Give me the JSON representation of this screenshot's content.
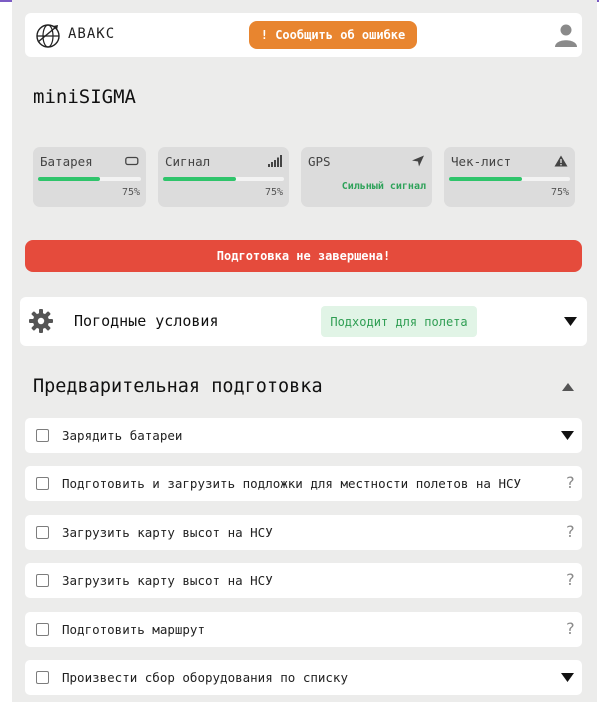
{
  "header": {
    "logo_text": "АВАКС",
    "report_button": "! Сообщить об ошибке"
  },
  "page_title": "miniSIGMA",
  "stats": [
    {
      "label": "Батарея",
      "percent": "75%",
      "progress": 0.6
    },
    {
      "label": "Сигнал",
      "percent": "75%",
      "progress": 0.6
    },
    {
      "label": "GPS",
      "status": "Сильный сигнал"
    },
    {
      "label": "Чек-лист",
      "percent": "75%",
      "progress": 0.6
    }
  ],
  "alert": "Подготовка не завершена!",
  "weather": {
    "label": "Погодные условия",
    "badge": "Подходит для полета"
  },
  "section_title": "Предварительная подготовка",
  "tasks": [
    {
      "label": "Зарядить батареи",
      "action": "expand"
    },
    {
      "label": "Подготовить и загрузить подложки для местности полетов на НСУ",
      "action": "help"
    },
    {
      "label": "Загрузить карту высот на НСУ",
      "action": "help"
    },
    {
      "label": "Загрузить карту высот на НСУ",
      "action": "help"
    },
    {
      "label": "Подготовить маршрут",
      "action": "help"
    },
    {
      "label": "Произвести сбор оборудования по списку",
      "action": "expand"
    }
  ],
  "colors": {
    "accent_orange": "#e8852f",
    "alert_red": "#e54b3c",
    "progress_green": "#2fc46b",
    "badge_green_bg": "#e1f4e6"
  },
  "icons": [
    "globe-logo-icon",
    "user-icon",
    "battery-icon",
    "signal-icon",
    "navigation-arrow-icon",
    "warning-icon",
    "gear-icon",
    "chevron-down-icon",
    "chevron-up-icon",
    "help-icon"
  ]
}
